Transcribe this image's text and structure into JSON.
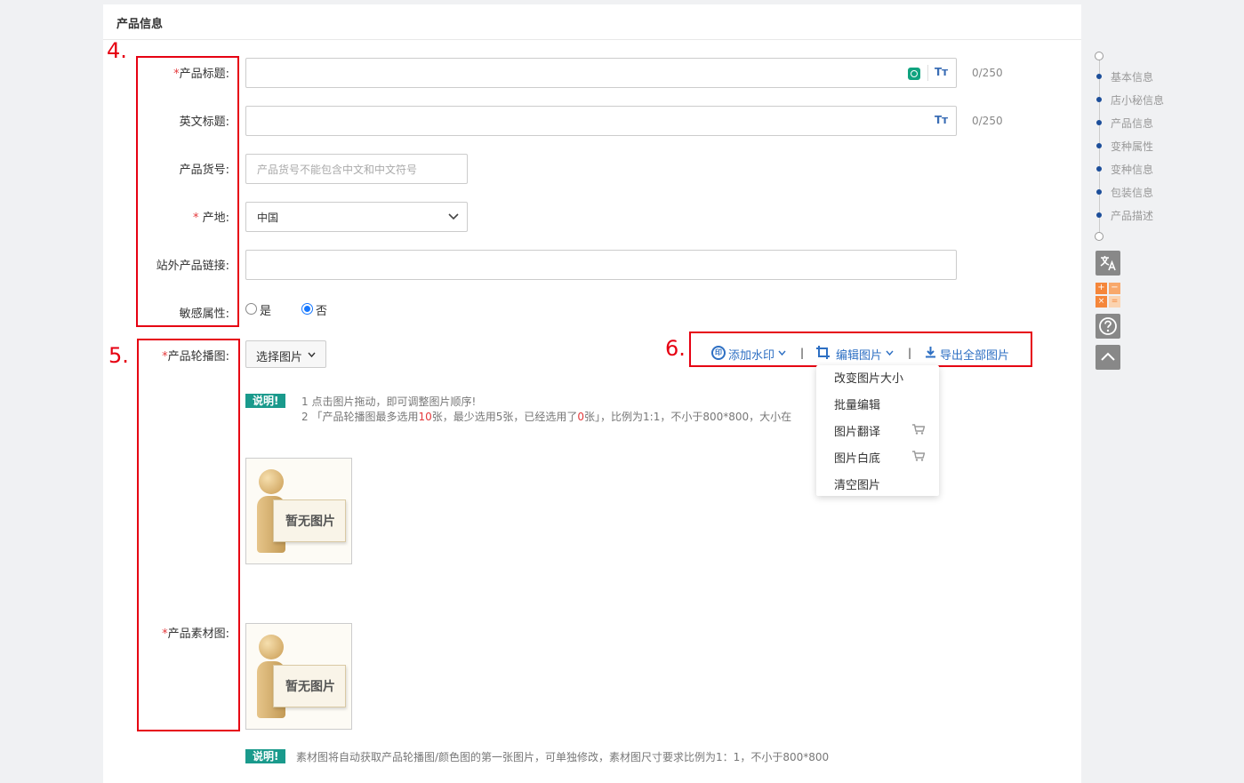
{
  "section": {
    "title": "产品信息"
  },
  "annotations": {
    "a4": "4.",
    "a5": "5.",
    "a6": "6."
  },
  "form": {
    "product_title": {
      "star": "*",
      "label": "产品标题:",
      "value": "",
      "counter": "0/250",
      "tt": "Tт"
    },
    "english_title": {
      "label": "英文标题:",
      "value": "",
      "counter": "0/250",
      "tt": "Tт"
    },
    "product_sku": {
      "label": "产品货号:",
      "placeholder": "产品货号不能包含中文和中文符号"
    },
    "origin": {
      "star": "*",
      "label": "产地:",
      "value": "中国"
    },
    "external_link": {
      "label": "站外产品链接:",
      "value": ""
    },
    "sensitive": {
      "label": "敏感属性:",
      "options": [
        "是",
        "否"
      ],
      "selected": "否"
    }
  },
  "carousel": {
    "star": "*",
    "label": "产品轮播图:",
    "select_button": "选择图片",
    "toolbar": {
      "watermark": "添加水印",
      "edit_image": "编辑图片",
      "export_all": "导出全部图片",
      "separator": "|"
    },
    "note_tag": "说明!",
    "note_line1": "1 点击图片拖动，即可调整图片顺序!",
    "note_line2_pre": "2 「产品轮播图最多选用",
    "note_line2_max": "10",
    "note_line2_mid": "张，最少选用5张，已经选用了",
    "note_line2_used": "0",
    "note_line2_post": "张」，比例为1:1，不小于800*800，大小在",
    "placeholder_image_text": "暂无图片"
  },
  "material": {
    "star": "*",
    "label": "产品素材图:",
    "placeholder_image_text": "暂无图片",
    "note_tag": "说明!",
    "note": "素材图将自动获取产品轮播图/颜色图的第一张图片，可单独修改，素材图尺寸要求比例为1：1，不小于800*800"
  },
  "edit_dropdown": {
    "items": [
      "改变图片大小",
      "批量编辑",
      "图片翻译",
      "图片白底",
      "清空图片"
    ]
  },
  "side_nav": {
    "items": [
      "基本信息",
      "店小秘信息",
      "产品信息",
      "变种属性",
      "变种信息",
      "包装信息",
      "产品描述"
    ]
  },
  "tools": {
    "translate_icon": "translate-icon",
    "calculator_icon": "calculator-icon",
    "help_icon": "help-icon",
    "scroll_top_icon": "chevron-up-icon"
  },
  "colors": {
    "accent": "#2d6fc3",
    "annotation": "#e60012",
    "note_tag": "#1a9a8c",
    "nav_dot": "#1c4e9a"
  }
}
